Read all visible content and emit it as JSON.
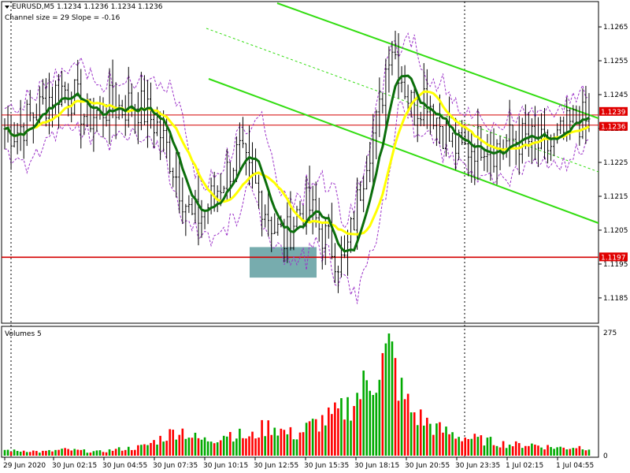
{
  "header": {
    "symbol_line": "EURUSD,M5  1.1234 1.1236 1.1234 1.1236",
    "channel_line": "Channel size = 29 Slope = -0.16",
    "volume_title": "Volumes 5"
  },
  "colors": {
    "bull": "#000000",
    "bear": "#000000",
    "ma_fast": "#0b6e0b",
    "ma_slow": "#ffff00",
    "envelope": "#9b30c8",
    "channel": "#33dd11",
    "level_line": "#d40000",
    "level_label_bg": "#e00000",
    "zone": "#5f9ea0",
    "vol_up": "#00aa00",
    "vol_down": "#ff0000",
    "grid": "#000000"
  },
  "chart_data": [
    {
      "type": "candlestick",
      "title": "EURUSD,M5",
      "ylim": [
        1.1178,
        1.1272
      ],
      "yticks": [
        "1.1265",
        "1.1255",
        "1.1245",
        "1.1235",
        "1.1225",
        "1.1215",
        "1.1205",
        "1.1195",
        "1.1185"
      ],
      "xticks": [
        "29 Jun 2020",
        "30 Jun 02:15",
        "30 Jun 04:55",
        "30 Jun 07:35",
        "30 Jun 10:15",
        "30 Jun 12:55",
        "30 Jun 15:35",
        "30 Jun 18:15",
        "30 Jun 20:55",
        "30 Jun 23:35",
        "1 Jul 02:15",
        "1 Jul 04:55"
      ],
      "close_path": [
        1.1235,
        1.1234,
        1.1238,
        1.1241,
        1.1245,
        1.1247,
        1.1244,
        1.1238,
        1.124,
        1.1242,
        1.1241,
        1.1243,
        1.124,
        1.1236,
        1.1228,
        1.1218,
        1.1208,
        1.121,
        1.1216,
        1.1222,
        1.1228,
        1.122,
        1.1214,
        1.1206,
        1.1202,
        1.121,
        1.1212,
        1.1205,
        1.12,
        1.1194,
        1.121,
        1.1228,
        1.1238,
        1.1262,
        1.125,
        1.124,
        1.1246,
        1.1238,
        1.1232,
        1.1228,
        1.123,
        1.1232,
        1.1229,
        1.1231,
        1.1232,
        1.1231,
        1.1229,
        1.123,
        1.1234,
        1.1238,
        1.1236
      ],
      "levels": [
        {
          "price": 1.1239,
          "label": "1.1239"
        },
        {
          "price": 1.1236,
          "label": "1.1236"
        },
        {
          "price": 1.1197,
          "label": "1.1197"
        }
      ],
      "zone": {
        "price_high": 1.12,
        "price_low": 1.1191
      },
      "channel": {
        "size": 29,
        "slope": -0.16
      }
    },
    {
      "type": "bar",
      "title": "Volumes 5",
      "ylim": [
        0,
        275
      ],
      "yticks": [
        "275",
        "0"
      ],
      "volume_path": [
        15,
        12,
        14,
        10,
        12,
        16,
        14,
        12,
        10,
        14,
        18,
        20,
        25,
        40,
        55,
        70,
        50,
        40,
        45,
        60,
        55,
        45,
        70,
        80,
        60,
        55,
        75,
        90,
        100,
        120,
        150,
        190,
        230,
        275,
        160,
        110,
        90,
        70,
        60,
        50,
        45,
        40,
        35,
        30,
        28,
        30,
        25,
        22,
        20,
        24,
        20
      ]
    }
  ]
}
